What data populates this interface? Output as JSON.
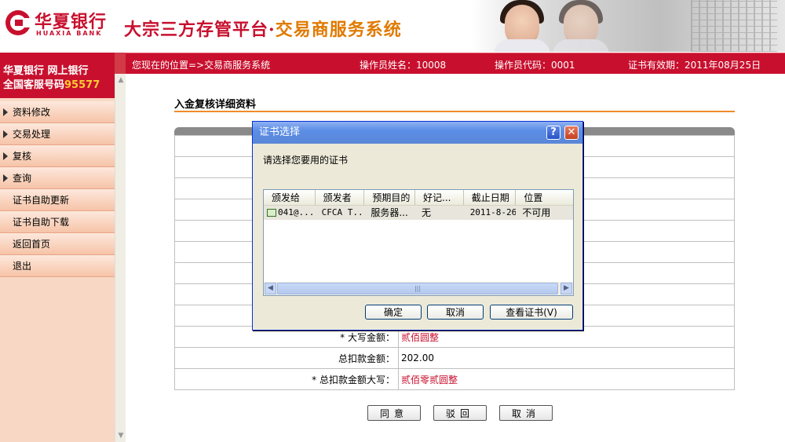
{
  "brand": {
    "bank_cn": "华夏银行",
    "bank_en": "HUAXIA BANK",
    "platform_main": "大宗三方存管平台",
    "platform_dot": "·",
    "platform_sub": "交易商服务系统",
    "accent_red": "#c8102e",
    "accent_orange": "#e07a00"
  },
  "navbar": {
    "location": "您现在的位置=>交易商服务系统",
    "operator_name": "操作员姓名：10008",
    "operator_code": "操作员代码：0001",
    "cert_expiry": "证书有效期：2011年08月25日"
  },
  "sidebar": {
    "promo_line1": "华夏银行  网上银行",
    "promo_line2_prefix": "全国客服号码",
    "promo_line2_number": "95577",
    "items": [
      {
        "label": "资料修改",
        "arrow": true
      },
      {
        "label": "交易处理",
        "arrow": true
      },
      {
        "label": "复核",
        "arrow": true
      },
      {
        "label": "查询",
        "arrow": true
      },
      {
        "label": "证书自助更新",
        "arrow": false
      },
      {
        "label": "证书自助下载",
        "arrow": false
      },
      {
        "label": "返回首页",
        "arrow": false
      },
      {
        "label": "退出",
        "arrow": false
      }
    ]
  },
  "main": {
    "title": "入金复核详细资料",
    "rows": [
      {
        "label": "* 大写金额：",
        "value": "贰佰圆整",
        "red": true
      },
      {
        "label": "总扣款金额：",
        "value": "202.00",
        "red": false
      },
      {
        "label": "* 总扣款金额大写：",
        "value": "贰佰零贰圆整",
        "red": true
      }
    ],
    "buttons": {
      "agree": "同意",
      "reject": "驳回",
      "cancel": "取消"
    }
  },
  "dialog": {
    "title": "证书选择",
    "help_label": "?",
    "close_label": "✕",
    "prompt": "请选择您要用的证书",
    "columns": [
      "颁发给",
      "颁发者",
      "预期目的",
      "好记...",
      "截止日期",
      "位置"
    ],
    "row": {
      "issued_to": "041@...",
      "issuer": "CFCA T...",
      "purpose": "服务器...",
      "friendly": "无",
      "expiry": "2011-8-26",
      "location": "不可用"
    },
    "scroll_left": "◀",
    "scroll_right": "▶",
    "scroll_grip": "|||",
    "ok": "确定",
    "cancel": "取消",
    "view_cert": "查看证书(V)"
  },
  "scroll": {
    "up": "▲",
    "down": "▼"
  }
}
